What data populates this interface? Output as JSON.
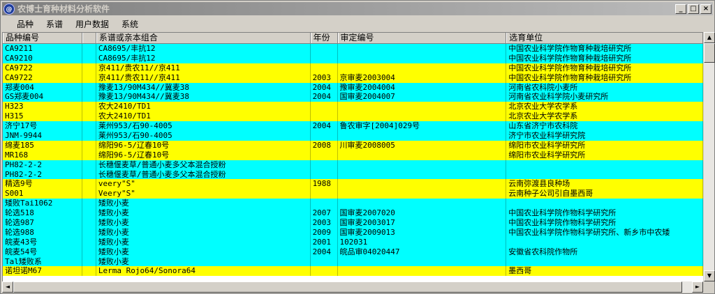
{
  "window": {
    "title": "农博士育种材料分析软件",
    "icon_label": "@",
    "buttons": {
      "minimize": "_",
      "maximize": "□",
      "close": "×"
    }
  },
  "menu": [
    "品种",
    "系谱",
    "用户数据",
    "系统"
  ],
  "table": {
    "columns": [
      "品种编号",
      "",
      "系谱或亲本组合",
      "年份",
      "审定编号",
      "选育单位"
    ],
    "rows": [
      {
        "color": "cyan",
        "cells": [
          "CA9211",
          "",
          "CA8695/丰抗12",
          "",
          "",
          "中国农业科学院作物育种栽培研究所"
        ]
      },
      {
        "color": "cyan",
        "cells": [
          "CA9210",
          "",
          "CA8695/丰抗12",
          "",
          "",
          "中国农业科学院作物育种栽培研究所"
        ]
      },
      {
        "color": "yellow",
        "cells": [
          "CA9722",
          "",
          "京411/贵农11//京411",
          "",
          "",
          "中国农业科学院作物育种栽培研究所"
        ]
      },
      {
        "color": "yellow",
        "cells": [
          "CA9722",
          "",
          "京411/贵农11//京411",
          "2003",
          "京审麦2003004",
          "中国农业科学院作物育种栽培研究所"
        ]
      },
      {
        "color": "cyan",
        "cells": [
          "郑麦004",
          "",
          "豫麦13/90M434//冀麦38",
          "2004",
          "豫审麦2004004",
          "河南省农科院小麦所"
        ]
      },
      {
        "color": "cyan",
        "cells": [
          "GS郑麦004",
          "",
          "豫麦13/90M434//冀麦38",
          "2004",
          "国审麦2004007",
          "河南省农业科学院小麦研究所"
        ]
      },
      {
        "color": "yellow",
        "cells": [
          "H323",
          "",
          "农大2410/TD1",
          "",
          "",
          "北京农业大学农学系"
        ]
      },
      {
        "color": "yellow",
        "cells": [
          "H315",
          "",
          "农大2410/TD1",
          "",
          "",
          "北京农业大学农学系"
        ]
      },
      {
        "color": "cyan",
        "cells": [
          "济宁17号",
          "",
          "莱州953/石90-4005",
          "2004",
          "鲁农审字[2004]029号",
          "山东省济宁市农科院"
        ]
      },
      {
        "color": "cyan",
        "cells": [
          "JNM-9944",
          "",
          "莱州953/石90-4005",
          "",
          "",
          "济宁市农业科学研究院"
        ]
      },
      {
        "color": "yellow",
        "cells": [
          "绵麦185",
          "",
          "绵阳96-5/辽春10号",
          "2008",
          "川审麦2008005",
          "绵阳市农业科学研究所"
        ]
      },
      {
        "color": "yellow",
        "cells": [
          "MR168",
          "",
          "绵阳96-5/辽春10号",
          "",
          "",
          "绵阳市农业科学研究所"
        ]
      },
      {
        "color": "cyan",
        "cells": [
          "PH82-2-2",
          "",
          "长穗偃麦草/普通小麦多父本混合授粉",
          "",
          "",
          ""
        ]
      },
      {
        "color": "cyan",
        "cells": [
          "PH82-2-2",
          "",
          "长穗偃麦草/普通小麦多父本混合授粉",
          "",
          "",
          ""
        ]
      },
      {
        "color": "yellow",
        "cells": [
          "精选9号",
          "",
          "veery\"S\"",
          "1988",
          "",
          "云南弥渡县良种场"
        ]
      },
      {
        "color": "yellow",
        "cells": [
          "S001",
          "",
          "Veery\"S\"",
          "",
          "",
          "云南种子公司引自墨西哥"
        ]
      },
      {
        "color": "cyan",
        "cells": [
          "矮败Tai1062",
          "",
          "矮败小麦",
          "",
          "",
          ""
        ]
      },
      {
        "color": "cyan",
        "cells": [
          "轮选518",
          "",
          "矮败小麦",
          "2007",
          "国审麦2007020",
          "中国农业科学院作物科学研究所"
        ]
      },
      {
        "color": "cyan",
        "cells": [
          "轮选987",
          "",
          "矮败小麦",
          "2003",
          "国审麦2003017",
          "中国农业科学院作物科学研究所"
        ]
      },
      {
        "color": "cyan",
        "cells": [
          "轮选988",
          "",
          "矮败小麦",
          "2009",
          "国审麦2009013",
          "中国农业科学院作物科学研究所、新乡市中农矮"
        ]
      },
      {
        "color": "cyan",
        "cells": [
          "皖麦43号",
          "",
          "矮败小麦",
          "2001",
          "102031",
          ""
        ]
      },
      {
        "color": "cyan",
        "cells": [
          "皖麦54号",
          "",
          "矮败小麦",
          "2004",
          "皖品审04020447",
          "安徽省农科院作物所"
        ]
      },
      {
        "color": "cyan",
        "cells": [
          "Tal矮败系",
          "",
          "矮败小麦",
          "",
          "",
          ""
        ]
      },
      {
        "color": "yellow",
        "cells": [
          "诺坦诺M67",
          "",
          "Lerma Rojo64/Sonora64",
          "",
          "",
          "墨西哥"
        ]
      }
    ]
  },
  "scrollbars": {
    "up": "▲",
    "down": "▼",
    "left": "◄",
    "right": "►"
  }
}
